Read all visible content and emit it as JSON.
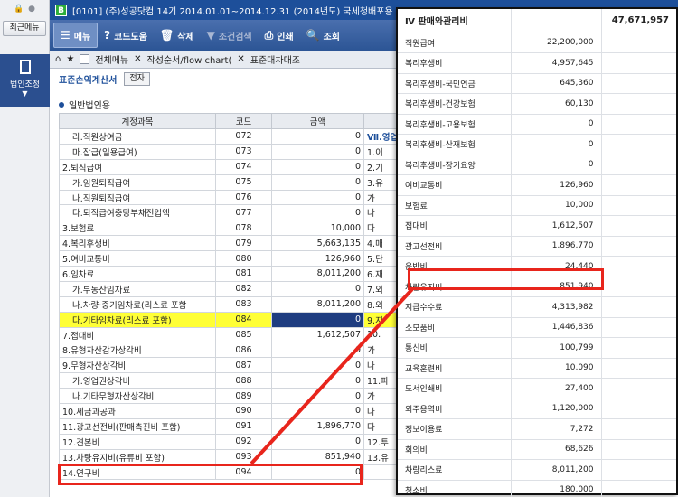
{
  "sidebar": {
    "recent_label": "최근메뉴",
    "corp_label": "법인조정"
  },
  "titlebar": {
    "app_badge": "B",
    "text": "[0101] (주)성공닷컴  14기 2014.01.01~2014.12.31 (2014년도)  국세청배포용"
  },
  "toolbar": {
    "menu": "메뉴",
    "code_help": "코드도움",
    "delete": "삭제",
    "cond_search": "조건검색",
    "print": "인쇄",
    "view": "조회"
  },
  "tabs": {
    "all_menu": "전체메뉴",
    "flow": "작성순서/flow chart(",
    "current": "표준대차대조"
  },
  "form": {
    "title": "표준손익계산서",
    "btn": "전자",
    "section": "일반법인용"
  },
  "main_table": {
    "headers": [
      "계정과목",
      "코드",
      "금액"
    ],
    "rows": [
      {
        "name": "라.직원상여금",
        "code": "072",
        "amount": "0",
        "right": "Ⅶ.영업"
      },
      {
        "name": "마.잡급(일용급여)",
        "code": "073",
        "amount": "0",
        "right": "1.이"
      },
      {
        "name": "2.퇴직급여",
        "code": "074",
        "amount": "0",
        "right": "2.기"
      },
      {
        "name": "가.임원퇴직급여",
        "code": "075",
        "amount": "0",
        "right": "3.유"
      },
      {
        "name": "나.직원퇴직급여",
        "code": "076",
        "amount": "0",
        "right": "가"
      },
      {
        "name": "다.퇴직급여충당부채전입액",
        "code": "077",
        "amount": "0",
        "right": "나"
      },
      {
        "name": "3.보험료",
        "code": "078",
        "amount": "10,000",
        "right": "다"
      },
      {
        "name": "4.복리후생비",
        "code": "079",
        "amount": "5,663,135",
        "right": "4.매"
      },
      {
        "name": "5.여비교통비",
        "code": "080",
        "amount": "126,960",
        "right": "5.단"
      },
      {
        "name": "6.임차료",
        "code": "081",
        "amount": "8,011,200",
        "right": "6.재"
      },
      {
        "name": "가.부동산임차료",
        "code": "082",
        "amount": "0",
        "right": "7.외"
      },
      {
        "name": "나.차량·중기임차료(리스료 포함",
        "code": "083",
        "amount": "8,011,200",
        "right": "8.외"
      },
      {
        "name": "다.기타임차료(리스료 포함)",
        "code": "084",
        "amount": "0",
        "right": "9.지"
      },
      {
        "name": "7.접대비",
        "code": "085",
        "amount": "1,612,507",
        "right": "10."
      },
      {
        "name": "8.유형자산감가상각비",
        "code": "086",
        "amount": "0",
        "right": "가"
      },
      {
        "name": "9.무형자산상각비",
        "code": "087",
        "amount": "0",
        "right": "나"
      },
      {
        "name": "가.영업권상각비",
        "code": "088",
        "amount": "0",
        "right": "11.파"
      },
      {
        "name": "나.기타무형자산상각비",
        "code": "089",
        "amount": "0",
        "right": "가"
      },
      {
        "name": "10.세금과공과",
        "code": "090",
        "amount": "0",
        "right": "나"
      },
      {
        "name": "11.광고선전비(판매촉진비 포함)",
        "code": "091",
        "amount": "1,896,770",
        "right": "다"
      },
      {
        "name": "12.견본비",
        "code": "092",
        "amount": "0",
        "right": "12.투"
      },
      {
        "name": "13.차량유지비(유류비 포함)",
        "code": "093",
        "amount": "851,940",
        "right": "13.유"
      },
      {
        "name": "14.연구비",
        "code": "094",
        "amount": "0",
        "right": ""
      }
    ]
  },
  "popup": {
    "header": {
      "name": "Ⅳ 판매와관리비",
      "amount": "47,671,957"
    },
    "rows": [
      {
        "name": "직원급여",
        "amount": "22,200,000"
      },
      {
        "name": "복리후생비",
        "amount": "4,957,645"
      },
      {
        "name": "복리후생비-국민연금",
        "amount": "645,360"
      },
      {
        "name": "복리후생비-건강보험",
        "amount": "60,130"
      },
      {
        "name": "복리후생비-고용보험",
        "amount": "0"
      },
      {
        "name": "복리후생비-산재보험",
        "amount": "0"
      },
      {
        "name": "복리후생비-장기요양",
        "amount": "0"
      },
      {
        "name": "여비교통비",
        "amount": "126,960"
      },
      {
        "name": "보험료",
        "amount": "10,000"
      },
      {
        "name": "접대비",
        "amount": "1,612,507"
      },
      {
        "name": "광고선전비",
        "amount": "1,896,770"
      },
      {
        "name": "운반비",
        "amount": "24,440"
      },
      {
        "name": "차량유지비",
        "amount": "851,940"
      },
      {
        "name": "지급수수료",
        "amount": "4,313,982"
      },
      {
        "name": "소모품비",
        "amount": "1,446,836"
      },
      {
        "name": "통신비",
        "amount": "100,799"
      },
      {
        "name": "교육훈련비",
        "amount": "10,090"
      },
      {
        "name": "도서인쇄비",
        "amount": "27,400"
      },
      {
        "name": "외주용역비",
        "amount": "1,120,000"
      },
      {
        "name": "정보이용료",
        "amount": "7,272"
      },
      {
        "name": "회의비",
        "amount": "68,626"
      },
      {
        "name": "차량리스료",
        "amount": "8,011,200"
      },
      {
        "name": "청소비",
        "amount": "180,000"
      }
    ]
  },
  "colors": {
    "highlight": "#e8251c",
    "brand": "#1d4f9a",
    "selected_row": "#ffff36"
  }
}
